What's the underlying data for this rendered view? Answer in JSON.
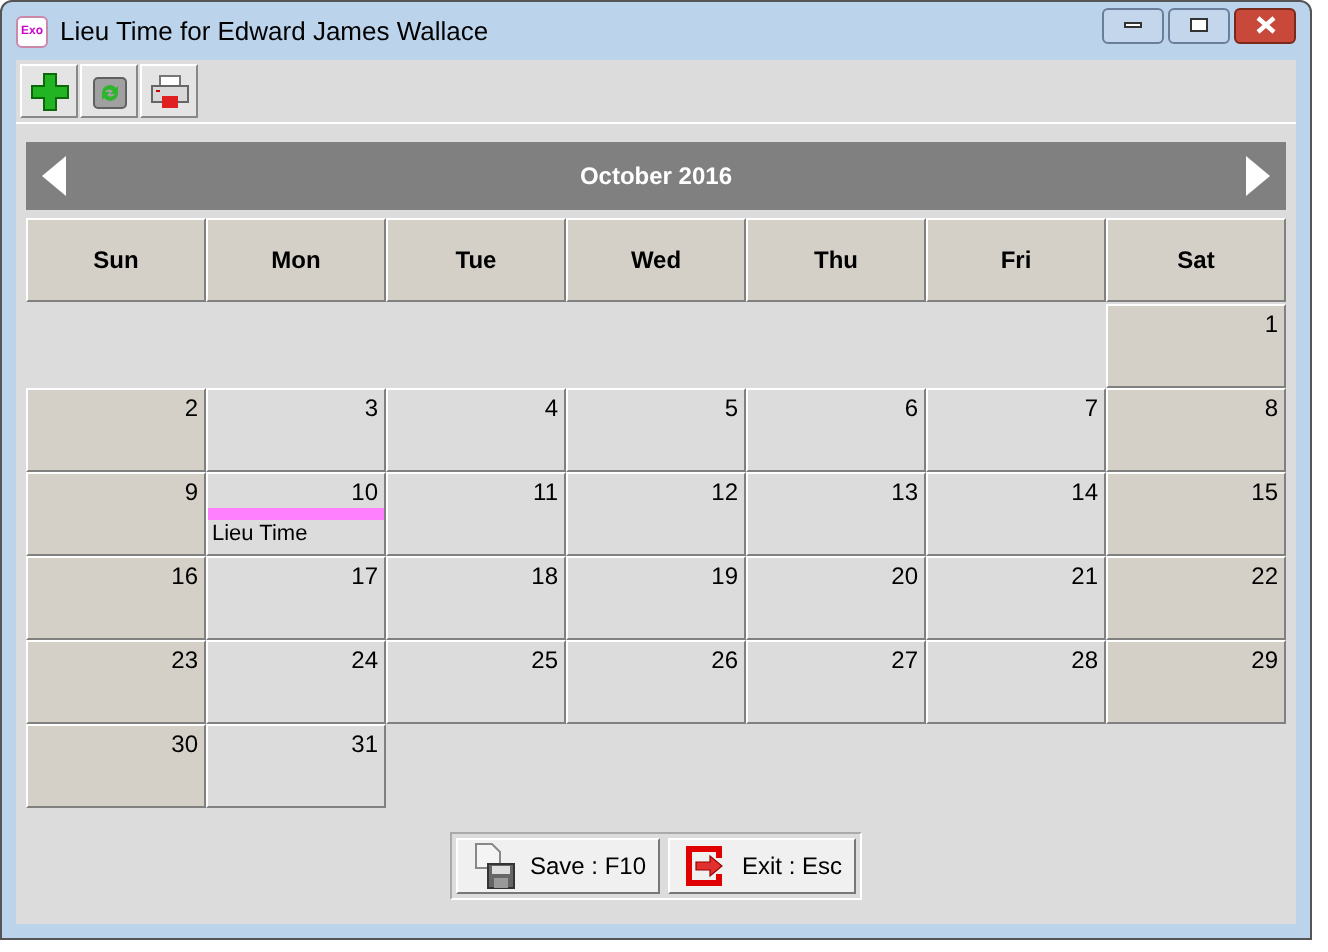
{
  "window": {
    "title": "Lieu Time for Edward James Wallace",
    "app_badge": "Exo"
  },
  "calendar": {
    "title": "October 2016",
    "weekdays": [
      {
        "label": "Sun",
        "weekend": true
      },
      {
        "label": "Mon",
        "weekend": false
      },
      {
        "label": "Tue",
        "weekend": false
      },
      {
        "label": "Wed",
        "weekend": false
      },
      {
        "label": "Thu",
        "weekend": false
      },
      {
        "label": "Fri",
        "weekend": false
      },
      {
        "label": "Sat",
        "weekend": true
      }
    ],
    "weeks": [
      [
        {
          "kind": "blank"
        },
        {
          "kind": "blank"
        },
        {
          "kind": "blank"
        },
        {
          "kind": "blank"
        },
        {
          "kind": "blank"
        },
        {
          "kind": "blank"
        },
        {
          "kind": "day",
          "day": "1"
        }
      ],
      [
        {
          "kind": "day",
          "day": "2"
        },
        {
          "kind": "day",
          "day": "3"
        },
        {
          "kind": "day",
          "day": "4"
        },
        {
          "kind": "day",
          "day": "5"
        },
        {
          "kind": "day",
          "day": "6"
        },
        {
          "kind": "day",
          "day": "7"
        },
        {
          "kind": "day",
          "day": "8"
        }
      ],
      [
        {
          "kind": "day",
          "day": "9"
        },
        {
          "kind": "day",
          "day": "10",
          "events": [
            {
              "label": "Lieu Time",
              "color": "#ff80ff"
            }
          ]
        },
        {
          "kind": "day",
          "day": "11"
        },
        {
          "kind": "day",
          "day": "12"
        },
        {
          "kind": "day",
          "day": "13"
        },
        {
          "kind": "day",
          "day": "14"
        },
        {
          "kind": "day",
          "day": "15"
        }
      ],
      [
        {
          "kind": "day",
          "day": "16"
        },
        {
          "kind": "day",
          "day": "17"
        },
        {
          "kind": "day",
          "day": "18"
        },
        {
          "kind": "day",
          "day": "19"
        },
        {
          "kind": "day",
          "day": "20"
        },
        {
          "kind": "day",
          "day": "21"
        },
        {
          "kind": "day",
          "day": "22"
        }
      ],
      [
        {
          "kind": "day",
          "day": "23"
        },
        {
          "kind": "day",
          "day": "24"
        },
        {
          "kind": "day",
          "day": "25"
        },
        {
          "kind": "day",
          "day": "26"
        },
        {
          "kind": "day",
          "day": "27"
        },
        {
          "kind": "day",
          "day": "28"
        },
        {
          "kind": "day",
          "day": "29"
        }
      ],
      [
        {
          "kind": "day",
          "day": "30"
        },
        {
          "kind": "day",
          "day": "31"
        },
        {
          "kind": "blank"
        },
        {
          "kind": "blank"
        },
        {
          "kind": "blank"
        },
        {
          "kind": "blank"
        },
        {
          "kind": "blank"
        }
      ]
    ]
  },
  "buttons": [
    {
      "label": "Save : F10",
      "kind": "save"
    },
    {
      "label": "Exit : Esc",
      "kind": "exit"
    }
  ]
}
